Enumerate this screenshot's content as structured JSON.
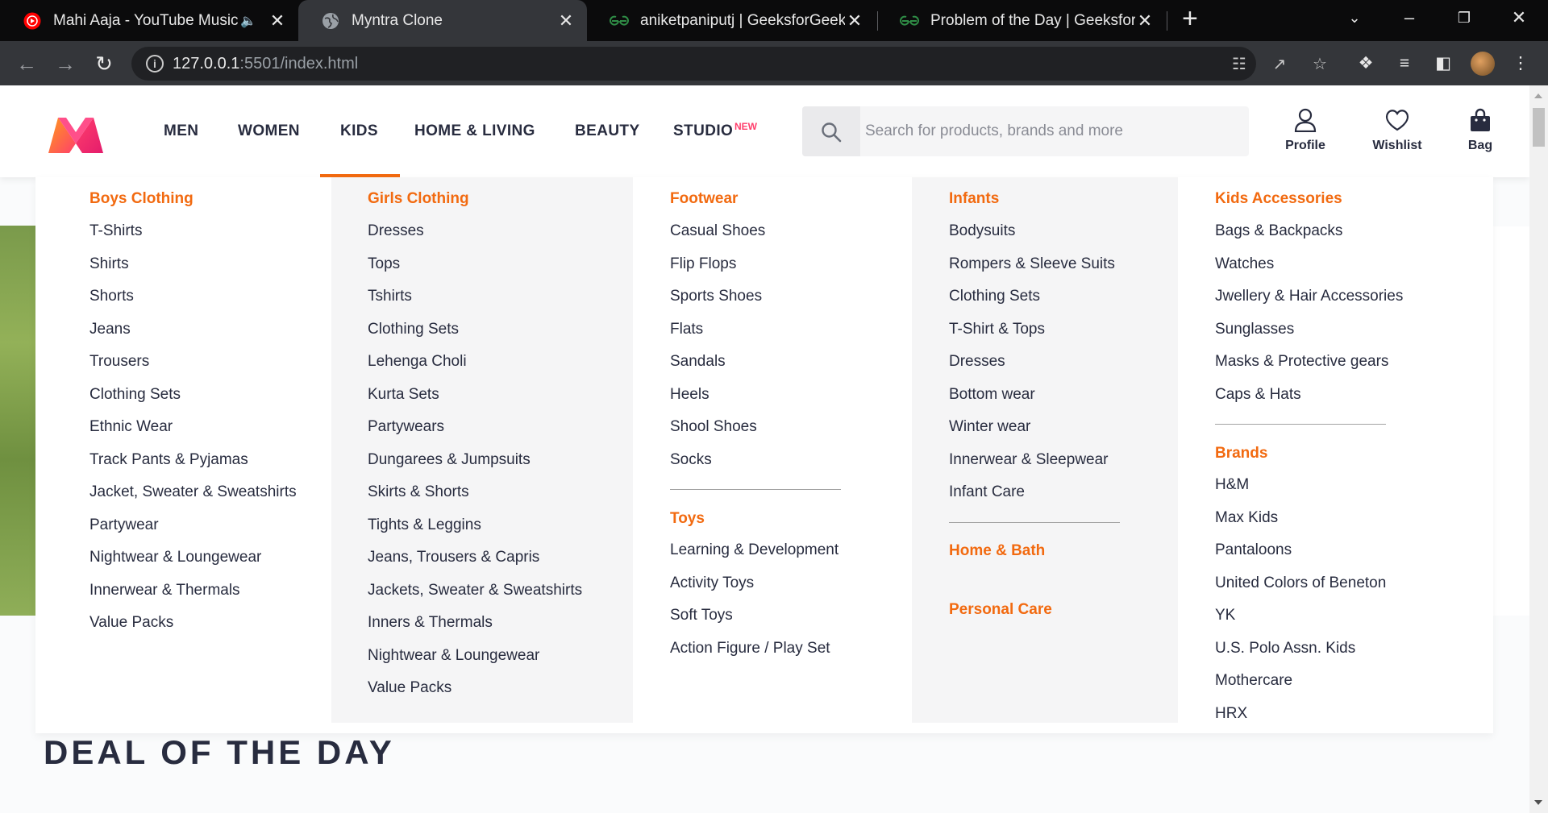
{
  "browser": {
    "tabs": [
      {
        "title": "Mahi Aaja - YouTube Music",
        "favicon": "youtube-music-icon",
        "audio": true
      },
      {
        "title": "Myntra Clone",
        "favicon": "globe-icon",
        "active": true
      },
      {
        "title": "aniketpaniputj | GeeksforGeeks P",
        "favicon": "geeksforgeeks-icon"
      },
      {
        "title": "Problem of the Day | GeeksforGe",
        "favicon": "geeksforgeeks-icon"
      }
    ],
    "url_host": "127.0.0.1",
    "url_rest": ":5501/index.html"
  },
  "header": {
    "nav": [
      "MEN",
      "WOMEN",
      "KIDS",
      "HOME & LIVING",
      "BEAUTY",
      "STUDIO"
    ],
    "studio_badge": "NEW",
    "search_placeholder": "Search for products, brands and more",
    "actions": [
      "Profile",
      "Wishlist",
      "Bag"
    ]
  },
  "mega_menu": {
    "columns": [
      {
        "sections": [
          {
            "heading": "Boys Clothing",
            "items": [
              "T-Shirts",
              "Shirts",
              "Shorts",
              "Jeans",
              "Trousers",
              "Clothing Sets",
              "Ethnic Wear",
              "Track Pants & Pyjamas",
              "Jacket, Sweater & Sweatshirts",
              "Partywear",
              "Nightwear & Loungewear",
              "Innerwear & Thermals",
              "Value Packs"
            ]
          }
        ]
      },
      {
        "sections": [
          {
            "heading": "Girls Clothing",
            "items": [
              "Dresses",
              "Tops",
              "Tshirts",
              "Clothing Sets",
              "Lehenga Choli",
              "Kurta Sets",
              "Partywears",
              "Dungarees & Jumpsuits",
              "Skirts & Shorts",
              "Tights & Leggins",
              "Jeans, Trousers & Capris",
              "Jackets, Sweater & Sweatshirts",
              "Inners & Thermals",
              "Nightwear & Loungewear",
              "Value Packs"
            ]
          }
        ]
      },
      {
        "sections": [
          {
            "heading": "Footwear",
            "items": [
              "Casual Shoes",
              "Flip Flops",
              "Sports Shoes",
              "Flats",
              "Sandals",
              "Heels",
              "Shool Shoes",
              "Socks"
            ]
          },
          {
            "heading": "Toys",
            "items": [
              "Learning & Development",
              "Activity Toys",
              "Soft Toys",
              "Action Figure / Play Set"
            ]
          }
        ]
      },
      {
        "sections": [
          {
            "heading": "Infants",
            "items": [
              "Bodysuits",
              "Rompers & Sleeve Suits",
              "Clothing Sets",
              "T-Shirt & Tops",
              "Dresses",
              "Bottom wear",
              "Winter wear",
              "Innerwear & Sleepwear",
              "Infant Care"
            ]
          },
          {
            "heading": "Home & Bath",
            "items": []
          },
          {
            "heading": "Personal Care",
            "items": []
          }
        ]
      },
      {
        "sections": [
          {
            "heading": "Kids Accessories",
            "items": [
              "Bags & Backpacks",
              "Watches",
              "Jwellery & Hair Accessories",
              "Sunglasses",
              "Masks & Protective gears",
              "Caps & Hats"
            ]
          },
          {
            "heading": "Brands",
            "items": [
              "H&M",
              "Max Kids",
              "Pantaloons",
              "United Colors of Beneton",
              "YK",
              "U.S. Polo Assn. Kids",
              "Mothercare",
              "HRX"
            ]
          }
        ]
      }
    ]
  },
  "deal_title": "DEAL OF THE DAY",
  "colors": {
    "accent": "#f26a10",
    "text": "#282c3f",
    "brand_pink": "#ff3f6c"
  }
}
